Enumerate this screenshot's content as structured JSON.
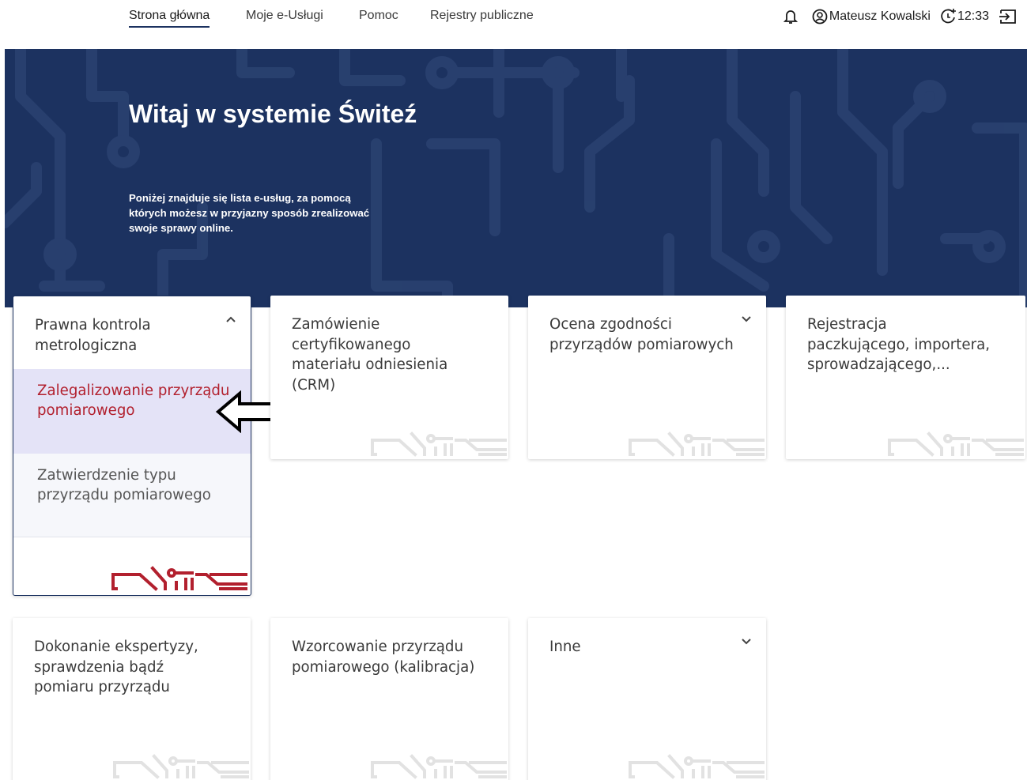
{
  "nav": {
    "items": [
      "Strona główna",
      "Moje e-Usługi",
      "Pomoc",
      "Rejestry publiczne"
    ],
    "active_index": 0
  },
  "header": {
    "user_name": "Mateusz Kowalski",
    "session_time": "12:33",
    "icons": [
      "bell-icon",
      "user-circle-icon",
      "session-timer-icon",
      "logout-icon"
    ]
  },
  "hero": {
    "title": "Witaj w systemie Świteź",
    "description": "Poniżej znajduje się lista e-usług, za pomocą których możesz w przyjazny sposób zrealizować swoje sprawy online."
  },
  "cards": [
    {
      "title": "Prawna kontrola metrologiczna",
      "expanded": true,
      "subitems": [
        {
          "label": "Zalegalizowanie przyrządu pomiarowego",
          "selected": true
        },
        {
          "label": "Zatwierdzenie typu przyrządu pomiarowego",
          "selected": false
        }
      ]
    },
    {
      "title": "Zamówienie certyfikowanego materiału odniesienia (CRM)",
      "expandable": false
    },
    {
      "title": "Ocena zgodności przyrządów pomiarowych",
      "expandable": true
    },
    {
      "title": "Rejestracja paczkującego, importera, sprowadzającego,...",
      "expandable": false
    },
    {
      "title": "Dokonanie ekspertyzy, sprawdzenia bądź pomiaru przyrządu",
      "expandable": false
    },
    {
      "title": "Wzorcowanie przyrządu pomiarowego (kalibracja)",
      "expandable": false
    },
    {
      "title": "Inne",
      "expandable": true
    }
  ],
  "colors": {
    "primary": "#1c3260",
    "accent": "#b2202e",
    "selected_bg": "#e4e3f7",
    "logo_grey": "#e2e2e2"
  }
}
